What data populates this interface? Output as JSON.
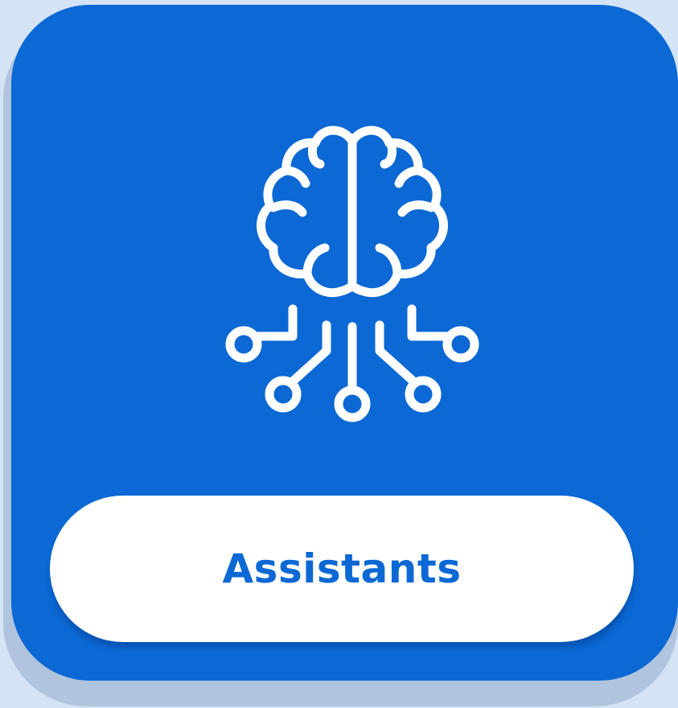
{
  "tile": {
    "label": "Assistants",
    "icon": "brain-circuit-icon",
    "colors": {
      "background": "#d4e3f5",
      "tile": "#0b68d4",
      "pill": "#ffffff",
      "label": "#0b68d4",
      "icon_stroke": "#ffffff"
    }
  }
}
